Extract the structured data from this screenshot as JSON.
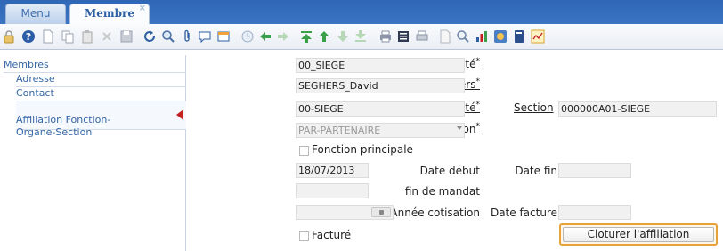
{
  "tabs": [
    {
      "label": "Menu"
    },
    {
      "label": "Membre",
      "close": "×"
    }
  ],
  "toolbar": {
    "icons": [
      "help-icon",
      "new-icon",
      "copy-icon",
      "paste-icon",
      "delete-icon",
      "save-icon",
      "refresh-icon",
      "search-icon",
      "attach-icon",
      "comment-icon",
      "window-icon",
      "clock-icon",
      "back-icon",
      "forward-icon",
      "first-icon",
      "previous-icon",
      "next-icon",
      "last-icon",
      "print-icon",
      "list-icon",
      "printer-icon",
      "document-icon",
      "zoom-icon",
      "chart-icon",
      "bird-icon",
      "book-icon",
      "report-icon"
    ]
  },
  "sidebar": {
    "items": [
      {
        "label": "Membres"
      },
      {
        "label": "Adresse"
      },
      {
        "label": "Contact"
      },
      {
        "label": "Affiliation Fonction-\nOrgane-Section"
      }
    ]
  },
  "form": {
    "unite1": {
      "label": "Unité",
      "required": "*",
      "value": "00_SIEGE"
    },
    "tiers": {
      "label": "Tiers",
      "required": "*",
      "value": "SEGHERS_David"
    },
    "unite2": {
      "label": "Unité",
      "required": "*",
      "value": "00-SIEGE"
    },
    "section": {
      "label": "Section",
      "value": "000000A01-SIEGE"
    },
    "fonction": {
      "label": "Fonction",
      "required": "*",
      "value": "PAR-PARTENAIRE"
    },
    "fonction_principale": {
      "label": "Fonction principale"
    },
    "date_debut": {
      "label": "Date début",
      "value": "18/07/2013"
    },
    "date_fin": {
      "label": "Date fin",
      "value": ""
    },
    "fin_mandat": {
      "label": "fin de mandat",
      "value": ""
    },
    "annee_cotisation": {
      "label": "Année cotisation",
      "value": ""
    },
    "date_facture": {
      "label": "Date facture",
      "value": ""
    },
    "facture": {
      "label": "Facturé"
    },
    "close_button": {
      "label": "Cloturer l'affiliation"
    }
  },
  "colors": {
    "tab_bar": "#2f67b6",
    "link_blue": "#3566a6",
    "selected_arrow": "#c42020",
    "button_highlight": "#e8a23a"
  }
}
